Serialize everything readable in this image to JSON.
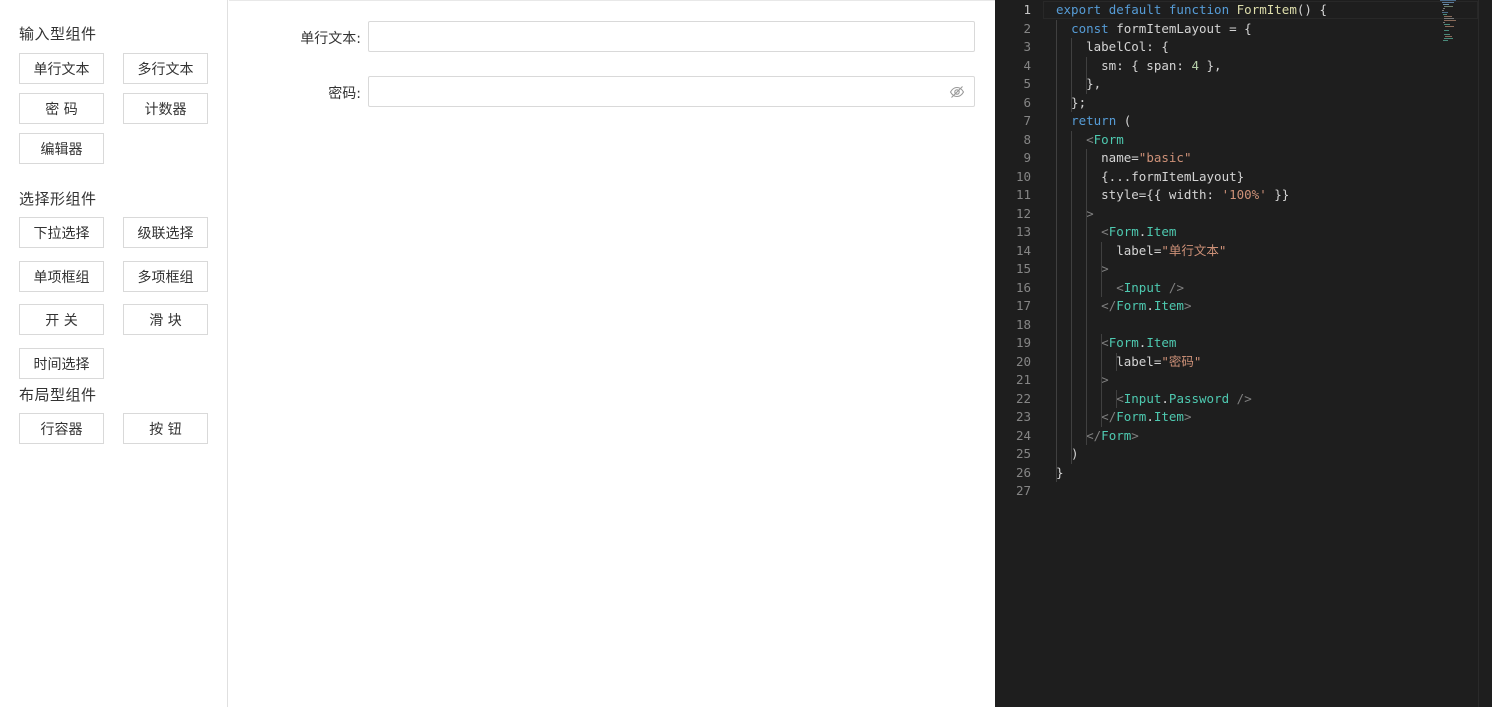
{
  "palette": {
    "groups": [
      {
        "title": "输入型组件",
        "items": [
          "单行文本",
          "多行文本",
          "密 码",
          "计数器",
          "编辑器"
        ]
      },
      {
        "title": "选择形组件",
        "items": [
          "下拉选择",
          "级联选择",
          "单项框组",
          "多项框组",
          "开 关",
          "滑 块",
          "时间选择"
        ]
      },
      {
        "title": "布局型组件",
        "items": [
          "行容器",
          "按 钮"
        ]
      }
    ]
  },
  "preview": {
    "fields": [
      {
        "label": "单行文本:",
        "value": "",
        "type": "text"
      },
      {
        "label": "密码:",
        "value": "",
        "type": "password",
        "suffix_icon": "eye-invisible-icon"
      }
    ]
  },
  "editor": {
    "active_line": 1,
    "line_numbers": [
      "1",
      "2",
      "3",
      "4",
      "5",
      "6",
      "7",
      "8",
      "9",
      "10",
      "11",
      "12",
      "13",
      "14",
      "15",
      "16",
      "17",
      "18",
      "19",
      "20",
      "21",
      "22",
      "23",
      "24",
      "25",
      "26",
      "27"
    ],
    "lines": [
      "export default function FormItem() {",
      "  const formItemLayout = {",
      "    labelCol: {",
      "      sm: { span: 4 },",
      "    },",
      "  };",
      "  return (",
      "    <Form",
      "      name=\"basic\"",
      "      {...formItemLayout}",
      "      style={{ width: '100%' }}",
      "    >",
      "      <Form.Item",
      "        label=\"单行文本\"",
      "      >",
      "        <Input />",
      "      </Form.Item>",
      "",
      "      <Form.Item",
      "        label=\"密码\"",
      "      >",
      "        <Input.Password />",
      "      </Form.Item>",
      "    </Form>",
      "  )",
      "}",
      ""
    ]
  },
  "colors": {
    "editor_bg": "#1e1e1e",
    "keyword": "#569cd6",
    "function": "#dcdcaa",
    "type": "#4ec9b0",
    "string": "#ce9178",
    "number": "#b5cea8",
    "border": "#d9d9d9"
  }
}
